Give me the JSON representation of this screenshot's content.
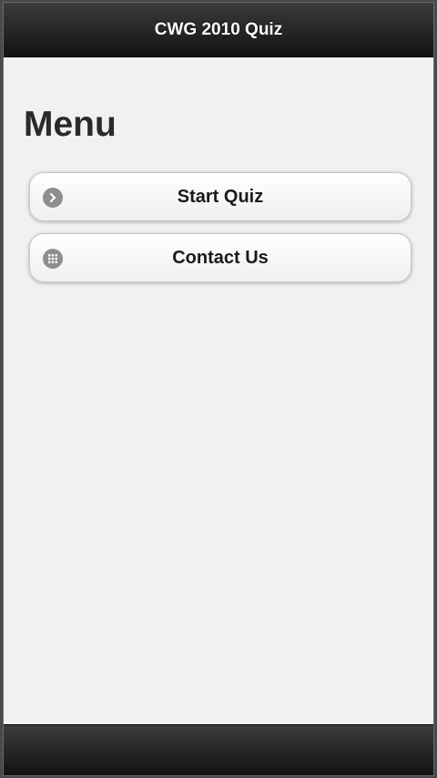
{
  "header": {
    "title": "CWG 2010 Quiz"
  },
  "page": {
    "title": "Menu"
  },
  "menu": {
    "items": [
      {
        "label": "Start Quiz",
        "icon": "arrow-right-icon"
      },
      {
        "label": "Contact Us",
        "icon": "grid-icon"
      }
    ]
  },
  "colors": {
    "bar": "#1e1e1e",
    "background": "#f1f1f1",
    "icon": "#8e8e8e"
  }
}
